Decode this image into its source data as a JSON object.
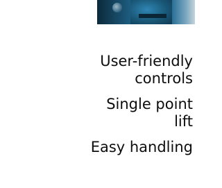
{
  "features": [
    {
      "label": "User-friendly controls"
    },
    {
      "label": "Single point lift"
    },
    {
      "label": "Easy handling"
    }
  ],
  "colors": {
    "text": "#0d0d0d",
    "background": "#ffffff",
    "image_blue": "#184a66"
  }
}
